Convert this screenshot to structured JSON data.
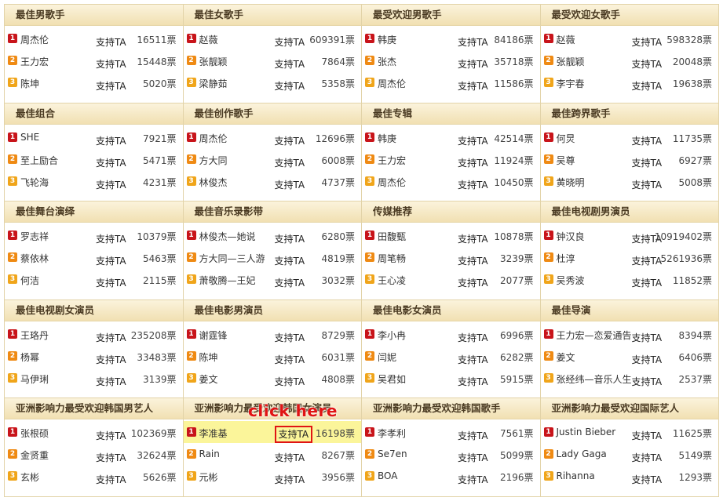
{
  "vote_label": "支持TA",
  "annotation": "click here",
  "rank_colors": {
    "1": "#c8141a",
    "2": "#ef8a13",
    "3": "#f0a51a"
  },
  "categories": [
    {
      "title": "最佳男歌手",
      "entries": [
        {
          "name": "周杰伦",
          "count": "16511票"
        },
        {
          "name": "王力宏",
          "count": "15448票"
        },
        {
          "name": "陈坤",
          "count": "5020票"
        }
      ]
    },
    {
      "title": "最佳女歌手",
      "entries": [
        {
          "name": "赵薇",
          "count": "609391票"
        },
        {
          "name": "张靓颖",
          "count": "7864票"
        },
        {
          "name": "梁静茹",
          "count": "5358票"
        }
      ]
    },
    {
      "title": "最受欢迎男歌手",
      "entries": [
        {
          "name": "韩庚",
          "count": "84186票"
        },
        {
          "name": "张杰",
          "count": "35718票"
        },
        {
          "name": "周杰伦",
          "count": "11586票"
        }
      ]
    },
    {
      "title": "最受欢迎女歌手",
      "entries": [
        {
          "name": "赵薇",
          "count": "598328票"
        },
        {
          "name": "张靓颖",
          "count": "20048票"
        },
        {
          "name": "李宇春",
          "count": "19638票"
        }
      ]
    },
    {
      "title": "最佳组合",
      "entries": [
        {
          "name": "SHE",
          "count": "7921票"
        },
        {
          "name": "至上励合",
          "count": "5471票"
        },
        {
          "name": "飞轮海",
          "count": "4231票"
        }
      ]
    },
    {
      "title": "最佳创作歌手",
      "entries": [
        {
          "name": "周杰伦",
          "count": "12696票"
        },
        {
          "name": "方大同",
          "count": "6008票"
        },
        {
          "name": "林俊杰",
          "count": "4737票"
        }
      ]
    },
    {
      "title": "最佳专辑",
      "entries": [
        {
          "name": "韩庚",
          "count": "42514票"
        },
        {
          "name": "王力宏",
          "count": "11924票"
        },
        {
          "name": "周杰伦",
          "count": "10450票"
        }
      ]
    },
    {
      "title": "最佳跨界歌手",
      "entries": [
        {
          "name": "何炅",
          "count": "11735票"
        },
        {
          "name": "吴尊",
          "count": "6927票"
        },
        {
          "name": "黄晓明",
          "count": "5008票"
        }
      ]
    },
    {
      "title": "最佳舞台演绎",
      "entries": [
        {
          "name": "罗志祥",
          "count": "10379票"
        },
        {
          "name": "蔡依林",
          "count": "5463票"
        },
        {
          "name": "何洁",
          "count": "2115票"
        }
      ]
    },
    {
      "title": "最佳音乐录影带",
      "entries": [
        {
          "name": "林俊杰—她说",
          "count": "6280票"
        },
        {
          "name": "方大同—三人游",
          "count": "4819票"
        },
        {
          "name": "萧敬腾—王妃",
          "count": "3032票"
        }
      ]
    },
    {
      "title": "传媒推荐",
      "entries": [
        {
          "name": "田馥甄",
          "count": "10878票"
        },
        {
          "name": "周笔畅",
          "count": "3239票"
        },
        {
          "name": "王心凌",
          "count": "2077票"
        }
      ]
    },
    {
      "title": "最佳电视剧男演员",
      "entries": [
        {
          "name": "钟汉良",
          "count": "10919402票"
        },
        {
          "name": "杜淳",
          "count": "5261936票"
        },
        {
          "name": "吴秀波",
          "count": "11852票"
        }
      ]
    },
    {
      "title": "最佳电视剧女演员",
      "entries": [
        {
          "name": "王珞丹",
          "count": "235208票"
        },
        {
          "name": "杨幂",
          "count": "33483票"
        },
        {
          "name": "马伊琍",
          "count": "3139票"
        }
      ]
    },
    {
      "title": "最佳电影男演员",
      "entries": [
        {
          "name": "谢霆锋",
          "count": "8729票"
        },
        {
          "name": "陈坤",
          "count": "6031票"
        },
        {
          "name": "姜文",
          "count": "4808票"
        }
      ]
    },
    {
      "title": "最佳电影女演员",
      "entries": [
        {
          "name": "李小冉",
          "count": "6996票"
        },
        {
          "name": "闫妮",
          "count": "6282票"
        },
        {
          "name": "吴君如",
          "count": "5915票"
        }
      ]
    },
    {
      "title": "最佳导演",
      "entries": [
        {
          "name": "王力宏—恋爱通告",
          "count": "8394票"
        },
        {
          "name": "姜文",
          "count": "6406票"
        },
        {
          "name": "张经纬—音乐人生",
          "count": "2537票"
        }
      ]
    },
    {
      "title": "亚洲影响力最受欢迎韩国男艺人",
      "entries": [
        {
          "name": "张根硕",
          "count": "102369票"
        },
        {
          "name": "金贤重",
          "count": "32624票"
        },
        {
          "name": "玄彬",
          "count": "5626票"
        }
      ]
    },
    {
      "title": "亚洲影响力最受欢迎韩国女演员",
      "entries": [
        {
          "name": "李准基",
          "count": "16198票"
        },
        {
          "name": "Rain",
          "count": "8267票"
        },
        {
          "name": "元彬",
          "count": "3956票"
        }
      ]
    },
    {
      "title": "亚洲影响力最受欢迎韩国歌手",
      "entries": [
        {
          "name": "李孝利",
          "count": "7561票"
        },
        {
          "name": "Se7en",
          "count": "5099票"
        },
        {
          "name": "BOA",
          "count": "2196票"
        }
      ]
    },
    {
      "title": "亚洲影响力最受欢迎国际艺人",
      "entries": [
        {
          "name": "Justin Bieber",
          "count": "11625票"
        },
        {
          "name": "Lady Gaga",
          "count": "5149票"
        },
        {
          "name": "Rihanna",
          "count": "1293票"
        }
      ]
    }
  ]
}
